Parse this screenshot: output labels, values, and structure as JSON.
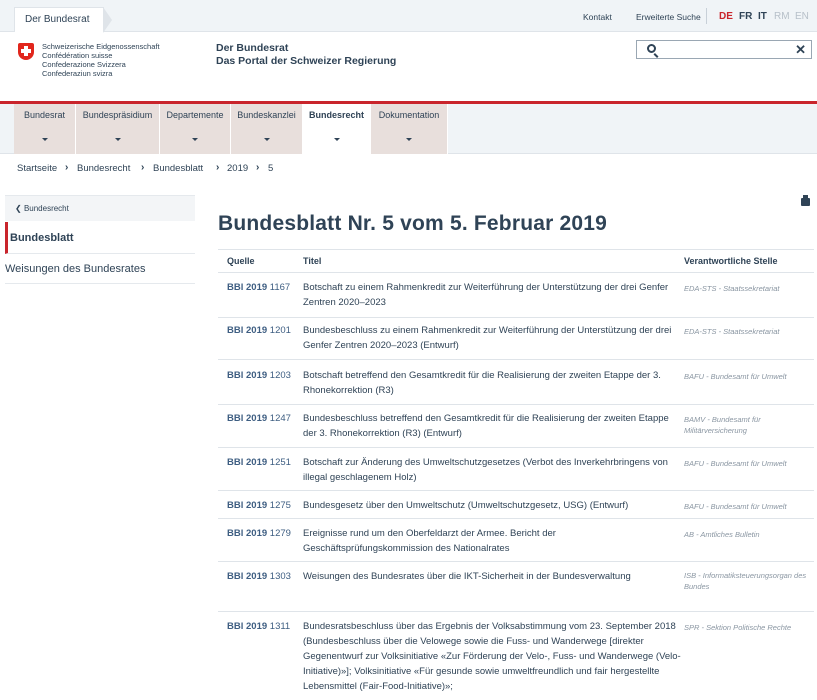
{
  "topbar": {
    "home_tab": "Der Bundesrat",
    "links": {
      "contact": "Kontakt",
      "advanced_search": "Erweiterte Suche"
    },
    "languages": [
      {
        "code": "DE",
        "active": true
      },
      {
        "code": "FR",
        "active": false
      },
      {
        "code": "IT",
        "active": false
      },
      {
        "code": "RM",
        "active": false
      },
      {
        "code": "EN",
        "active": false
      }
    ]
  },
  "header": {
    "confederation": [
      "Schweizerische Eidgenossenschaft",
      "Confédération suisse",
      "Confederazione Svizzera",
      "Confederaziun svizra"
    ],
    "portal_title_1": "Der Bundesrat",
    "portal_title_2": "Das Portal der Schweizer Regierung",
    "search": {
      "value": "",
      "placeholder": ""
    }
  },
  "nav": {
    "items": [
      {
        "label": "Bundesrat",
        "active": false
      },
      {
        "label": "Bundespräsidium",
        "active": false
      },
      {
        "label": "Departemente",
        "active": false
      },
      {
        "label": "Bundeskanzlei",
        "active": false
      },
      {
        "label": "Bundesrecht",
        "active": true
      },
      {
        "label": "Dokumentation",
        "active": false
      }
    ]
  },
  "breadcrumb": [
    "Startseite",
    "Bundesrecht",
    "Bundesblatt",
    "2019",
    "5"
  ],
  "sidebar": {
    "back_label": "Bundesrecht",
    "active_label": "Bundesblatt",
    "items": [
      "Weisungen des Bundesrates"
    ]
  },
  "main": {
    "title": "Bundesblatt Nr. 5 vom 5. Februar 2019",
    "columns": {
      "source": "Quelle",
      "title": "Titel",
      "office": "Verantwortliche Stelle"
    },
    "rows": [
      {
        "prefix": "BBl 2019",
        "page": "1167",
        "title": "Botschaft zu einem Rahmenkredit zur Weiterführung der Unterstützung der drei Genfer Zentren 2020–2023",
        "office": "EDA-STS - Staatssekretariat"
      },
      {
        "prefix": "BBl 2019",
        "page": "1201",
        "title": "Bundesbeschluss zu einem Rahmenkredit zur Weiterführung der Unterstützung der drei Genfer Zentren 2020–2023 (Entwurf)",
        "office": "EDA-STS - Staatssekretariat"
      },
      {
        "prefix": "BBl 2019",
        "page": "1203",
        "title": "Botschaft betreffend den Gesamtkredit für die Realisierung der zweiten Etappe der 3. Rhonekorrektion (R3)",
        "office": "BAFU - Bundesamt für Umwelt"
      },
      {
        "prefix": "BBl 2019",
        "page": "1247",
        "title": "Bundesbeschluss betreffend den Gesamtkredit für die Realisierung der zweiten Etappe der 3. Rhonekorrektion (R3) (Entwurf)",
        "office": "BAMV - Bundesamt für Militärversicherung"
      },
      {
        "prefix": "BBl 2019",
        "page": "1251",
        "title": "Botschaft zur Änderung des Umweltschutzgesetzes (Verbot des Inverkehrbringens von illegal geschlagenem Holz)",
        "office": "BAFU - Bundesamt für Umwelt"
      },
      {
        "prefix": "BBl 2019",
        "page": "1275",
        "title": "Bundesgesetz über den Umweltschutz (Umweltschutzgesetz, USG) (Entwurf)",
        "office": "BAFU - Bundesamt für Umwelt"
      },
      {
        "prefix": "BBl 2019",
        "page": "1279",
        "title": "Ereignisse rund um den Oberfeldarzt der Armee. Bericht der Geschäftsprüfungskommission des Nationalrates",
        "office": "AB - Amtliches Bulletin"
      },
      {
        "prefix": "BBl 2019",
        "page": "1303",
        "title": "Weisungen des Bundesrates über die IKT-Sicherheit in der Bundesverwaltung",
        "office": "ISB - Informatiksteuerungsorgan des Bundes"
      },
      {
        "prefix": "BBl 2019",
        "page": "1311",
        "title": "Bundesratsbeschluss über das Ergebnis der Volksabstimmung vom 23. September 2018 (Bundesbeschluss über die Velowege sowie die Fuss- und Wanderwege [direkter Gegenentwurf zur Volksinitiative «Zur Förderung der Velo-, Fuss- und Wanderwege (Velo-Initiative)»]; Volksinitiative «Für gesunde sowie umweltfreundlich und fair hergestellte Lebensmittel (Fair-Food-Initiative)»;",
        "office": "SPR - Sektion Politische Rechte"
      }
    ]
  },
  "colors": {
    "accent_red": "#c9252c",
    "link_blue": "#3e5e82",
    "text": "#2f4356",
    "muted": "#8a96a2"
  }
}
